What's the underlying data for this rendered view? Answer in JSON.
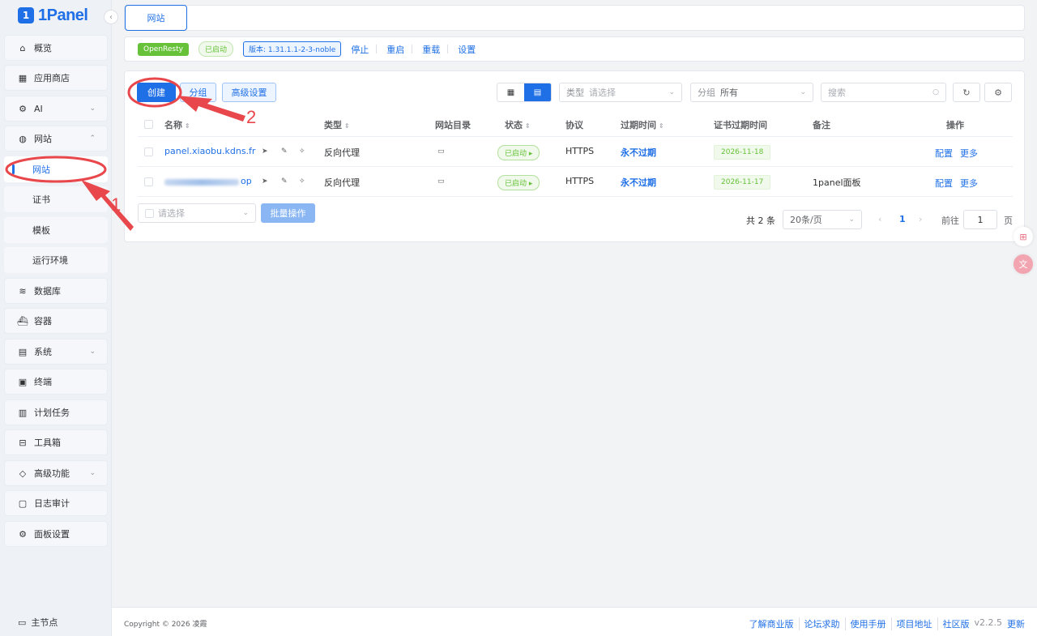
{
  "app": {
    "logo_text": "1Panel",
    "logo_mark": "1"
  },
  "sidebar": {
    "items": [
      {
        "label": "概览",
        "icon": "home-icon"
      },
      {
        "label": "应用商店",
        "icon": "grid-icon"
      },
      {
        "label": "AI",
        "icon": "robot-icon"
      },
      {
        "label": "网站",
        "icon": "globe-icon"
      },
      {
        "label": "数据库",
        "icon": "layers-icon"
      },
      {
        "label": "容器",
        "icon": "ship-icon"
      },
      {
        "label": "系统",
        "icon": "server-icon"
      },
      {
        "label": "终端",
        "icon": "terminal-icon"
      },
      {
        "label": "计划任务",
        "icon": "calendar-icon"
      },
      {
        "label": "工具箱",
        "icon": "toolbox-icon"
      },
      {
        "label": "高级功能",
        "icon": "diamond-icon"
      },
      {
        "label": "日志审计",
        "icon": "log-icon"
      },
      {
        "label": "面板设置",
        "icon": "settings-icon"
      }
    ],
    "sub_items": [
      "网站",
      "证书",
      "模板",
      "运行环境"
    ],
    "master_node": "主节点"
  },
  "tabs": [
    "网站"
  ],
  "openresty": {
    "name": "OpenResty",
    "status": "已启动",
    "version": "版本: 1.31.1.1-2-3-noble",
    "actions": [
      "停止",
      "重启",
      "重载",
      "设置"
    ]
  },
  "toolbar": {
    "create": "创建",
    "group": "分组",
    "advanced": "高级设置",
    "type_prefix": "类型",
    "type_placeholder": "请选择",
    "group_prefix": "分组",
    "group_value": "所有",
    "search_placeholder": "搜索"
  },
  "table": {
    "columns": [
      "名称",
      "类型",
      "网站目录",
      "状态",
      "协议",
      "过期时间",
      "证书过期时间",
      "备注",
      "操作"
    ],
    "rows": [
      {
        "name": "panel.xiaobu.kdns.fr",
        "type": "反向代理",
        "status": "已启动",
        "protocol": "HTTPS",
        "expire": "永不过期",
        "cert_expire": "2026-11-18",
        "remark": "",
        "action_config": "配置",
        "action_more": "更多"
      },
      {
        "name": "op",
        "type": "反向代理",
        "status": "已启动",
        "protocol": "HTTPS",
        "expire": "永不过期",
        "cert_expire": "2026-11-17",
        "remark": "1panel面板",
        "action_config": "配置",
        "action_more": "更多"
      }
    ]
  },
  "batch": {
    "placeholder": "请选择",
    "button": "批量操作"
  },
  "pagination": {
    "total": "共 2 条",
    "page_size": "20条/页",
    "current": "1",
    "goto_label": "前往",
    "goto_value": "1",
    "page_suffix": "页"
  },
  "footer": {
    "copyright": "Copyright © 2026 凌霞",
    "links": [
      "了解商业版",
      "论坛求助",
      "使用手册",
      "项目地址",
      "社区版"
    ],
    "version": "v2.2.5",
    "update": "更新"
  },
  "annotations": {
    "label1": "1",
    "label2": "2"
  },
  "colors": {
    "primary": "#1f6fe6",
    "success": "#67c23a",
    "annotation": "#e8474b"
  }
}
